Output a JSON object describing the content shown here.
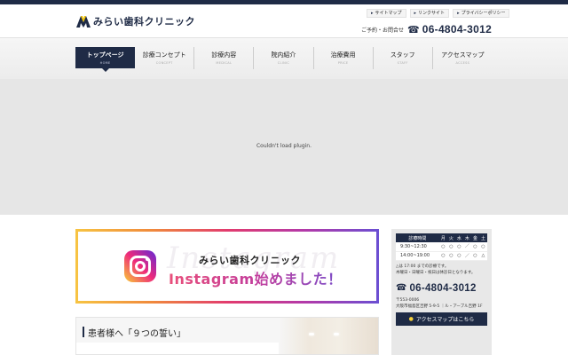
{
  "header": {
    "logo_text": "みらい歯科クリニック",
    "util_links": [
      "サイトマップ",
      "リンクサイト",
      "プライバシーポリシー"
    ],
    "contact_label": "ご予約・お問合せ",
    "phone": "06-4804-3012"
  },
  "nav": [
    {
      "jp": "トップページ",
      "en": "HOME",
      "active": true
    },
    {
      "jp": "診療コンセプト",
      "en": "CONCEPT"
    },
    {
      "jp": "診療内容",
      "en": "MEDICAL"
    },
    {
      "jp": "院内紹介",
      "en": "CLINIC"
    },
    {
      "jp": "治療費用",
      "en": "PRICE"
    },
    {
      "jp": "スタッフ",
      "en": "STAFF"
    },
    {
      "jp": "アクセスマップ",
      "en": "ACCESS"
    }
  ],
  "plugin_message": "Couldn't load plugin.",
  "instagram": {
    "watermark": "Instagram",
    "clinic": "みらい歯科クリニック",
    "title": "Instagram始めました！"
  },
  "hours": {
    "header": [
      "診療時間",
      "月",
      "火",
      "水",
      "木",
      "金",
      "土"
    ],
    "rows": [
      [
        "9:30~12:30",
        "○",
        "○",
        "○",
        "／",
        "○",
        "○"
      ],
      [
        "14:00~19:00",
        "○",
        "○",
        "○",
        "／",
        "○",
        "△"
      ]
    ],
    "note1": "△は 17:00 までの診療です。",
    "note2": "木曜日・日曜日・祝日は休診日となります。",
    "phone": "06-4804-3012",
    "zip": "〒553-0006",
    "address": "大阪市福島区吉野 5-9-5 ｜ル・アーブル吉野 1F",
    "access_button": "アクセスマップはこちら"
  },
  "promise": {
    "title": "患者様へ「９つの誓い」"
  },
  "colors": {
    "navy": "#1f2b46",
    "plugin_bg": "#e6e6e6",
    "instagram_pink": "#e0457a"
  }
}
